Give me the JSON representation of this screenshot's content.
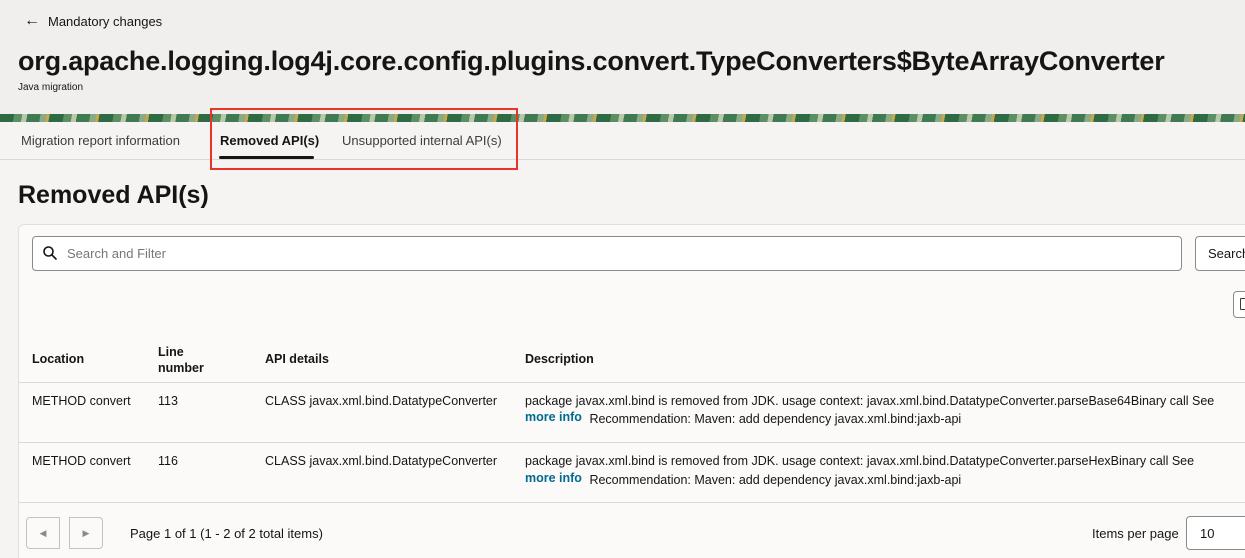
{
  "header": {
    "back_label": "Mandatory changes",
    "title": "org.apache.logging.log4j.core.config.plugins.convert.TypeConverters$ByteArrayConverter",
    "subtitle": "Java migration"
  },
  "tabs": [
    {
      "label": "Migration report information",
      "active": false
    },
    {
      "label": "Removed API(s)",
      "active": true
    },
    {
      "label": "Unsupported internal API(s)",
      "active": false
    }
  ],
  "section_title": "Removed API(s)",
  "search": {
    "placeholder": "Search and Filter",
    "value": "",
    "button_label": "Search"
  },
  "table": {
    "columns": [
      "Location",
      "Line number",
      "API details",
      "Description"
    ],
    "rows": [
      {
        "location": "METHOD convert",
        "line": "113",
        "api": "CLASS javax.xml.bind.DatatypeConverter",
        "desc_line1": "package javax.xml.bind is removed from JDK. usage context: javax.xml.bind.DatatypeConverter.parseBase64Binary call  See",
        "more_info": "more info",
        "recommendation": "Recommendation: Maven: add dependency javax.xml.bind:jaxb-api"
      },
      {
        "location": "METHOD convert",
        "line": "116",
        "api": "CLASS javax.xml.bind.DatatypeConverter",
        "desc_line1": "package javax.xml.bind is removed from JDK. usage context: javax.xml.bind.DatatypeConverter.parseHexBinary call  See",
        "more_info": "more info",
        "recommendation": "Recommendation: Maven: add dependency javax.xml.bind:jaxb-api"
      }
    ]
  },
  "pagination": {
    "status": "Page 1 of 1 (1 - 2 of 2 total items)",
    "items_per_page_label": "Items per page",
    "items_per_page_value": "10"
  },
  "colors": {
    "highlight": "#e8352a",
    "link": "#006b8f"
  }
}
